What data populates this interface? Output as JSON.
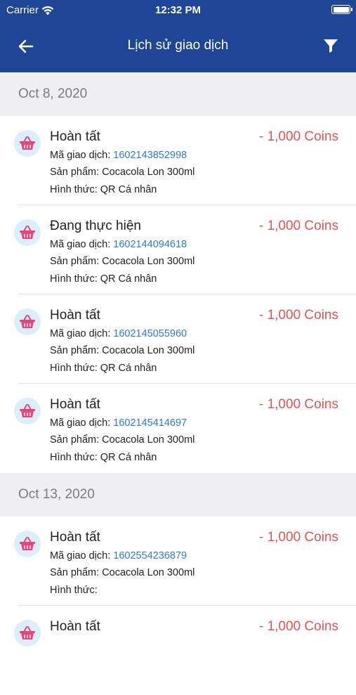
{
  "status_bar": {
    "carrier": "Carrier",
    "time": "12:32 PM"
  },
  "nav": {
    "title": "Lịch sử giao dịch"
  },
  "labels": {
    "code": "Mã giao dịch: ",
    "product": "Sản phẩm: ",
    "method": "Hình thức: "
  },
  "groups": [
    {
      "date": "Oct 8, 2020",
      "items": [
        {
          "status": "Hoàn tất",
          "amount": "- 1,000 Coins",
          "code": "1602143852998",
          "product": "Cocacola Lon 300ml",
          "method": "QR Cá nhân"
        },
        {
          "status": "Đang thực hiện",
          "amount": "- 1,000 Coins",
          "code": "1602144094618",
          "product": "Cocacola Lon 300ml",
          "method": "QR Cá nhân"
        },
        {
          "status": "Hoàn tất",
          "amount": "- 1,000 Coins",
          "code": "1602145055960",
          "product": "Cocacola Lon 300ml",
          "method": "QR Cá nhân"
        },
        {
          "status": "Hoàn tất",
          "amount": "- 1,000 Coins",
          "code": "1602145414697",
          "product": "Cocacola Lon 300ml",
          "method": "QR Cá nhân"
        }
      ]
    },
    {
      "date": "Oct 13, 2020",
      "items": [
        {
          "status": "Hoàn tất",
          "amount": "- 1,000 Coins",
          "code": "1602554236879",
          "product": "Cocacola Lon 300ml",
          "method": ""
        },
        {
          "status": "Hoàn tất",
          "amount": "- 1,000 Coins",
          "code": "",
          "product": "",
          "method": ""
        }
      ]
    }
  ],
  "colors": {
    "header": "#1f4596",
    "amount": "#e35353",
    "code": "#2a7bd4",
    "icon_bg": "#dbeffa",
    "basket": "#e8457a"
  },
  "icons": {
    "back": "arrow-left-icon",
    "filter": "filter-icon",
    "item": "basket-icon"
  }
}
